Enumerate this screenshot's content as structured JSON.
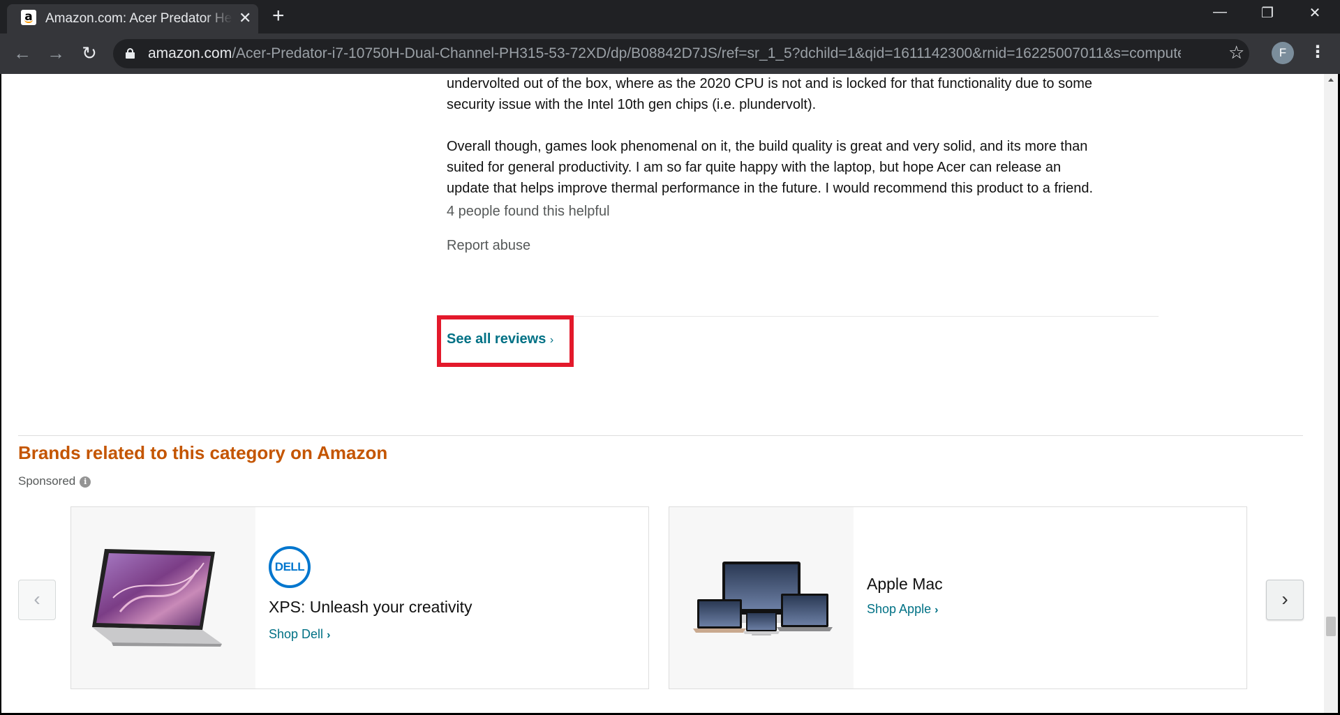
{
  "browser": {
    "tab_title": "Amazon.com: Acer Predator Helios 300 PH315-53-72XD",
    "tab_favicon": "a",
    "url_domain": "amazon.com",
    "url_path": "/Acer-Predator-i7-10750H-Dual-Channel-PH315-53-72XD/dp/B08842D7JS/ref=sr_1_5?dchild=1&qid=1611142300&rnid=16225007011&s=computers-...",
    "profile_initial": "F",
    "icons": [
      "back-icon",
      "forward-icon",
      "reload-icon",
      "lock-icon",
      "star-icon",
      "menu-icon",
      "close-icon",
      "new-tab-icon",
      "minimize-icon",
      "restore-icon"
    ]
  },
  "review": {
    "paragraph1_line1": "undervolted out of the box, where as the 2020 CPU is not and is locked for that functionality due to some",
    "paragraph1_line2": "security issue with the Intel 10th gen chips (i.e. plundervolt).",
    "paragraph2_line1": "Overall though, games look phenomenal on it, the build quality is great and very solid, and its more than",
    "paragraph2_line2": "suited for general productivity. I am so far quite happy with the laptop, but hope Acer can release an",
    "paragraph2_line3": "update that helps improve thermal performance in the future. I would recommend this product to a friend.",
    "helpful_text": "4 people found this helpful",
    "report_abuse": "Report abuse"
  },
  "see_all_reviews": {
    "label": "See all reviews",
    "chevron": "›",
    "highlight_color": "#e3192b"
  },
  "brands": {
    "title": "Brands related to this category on Amazon",
    "sponsored": "Sponsored",
    "info_glyph": "i",
    "prev_glyph": "‹",
    "next_glyph": "›",
    "cards": [
      {
        "brand_logo": "DELL",
        "title": "XPS: Unleash your creativity",
        "link": "Shop Dell",
        "chevron": "›"
      },
      {
        "title": "Apple Mac",
        "link": "Shop Apple",
        "chevron": "›"
      }
    ]
  },
  "colors": {
    "link": "#007185",
    "brand_heading": "#c45500",
    "text_secondary": "#565959"
  }
}
